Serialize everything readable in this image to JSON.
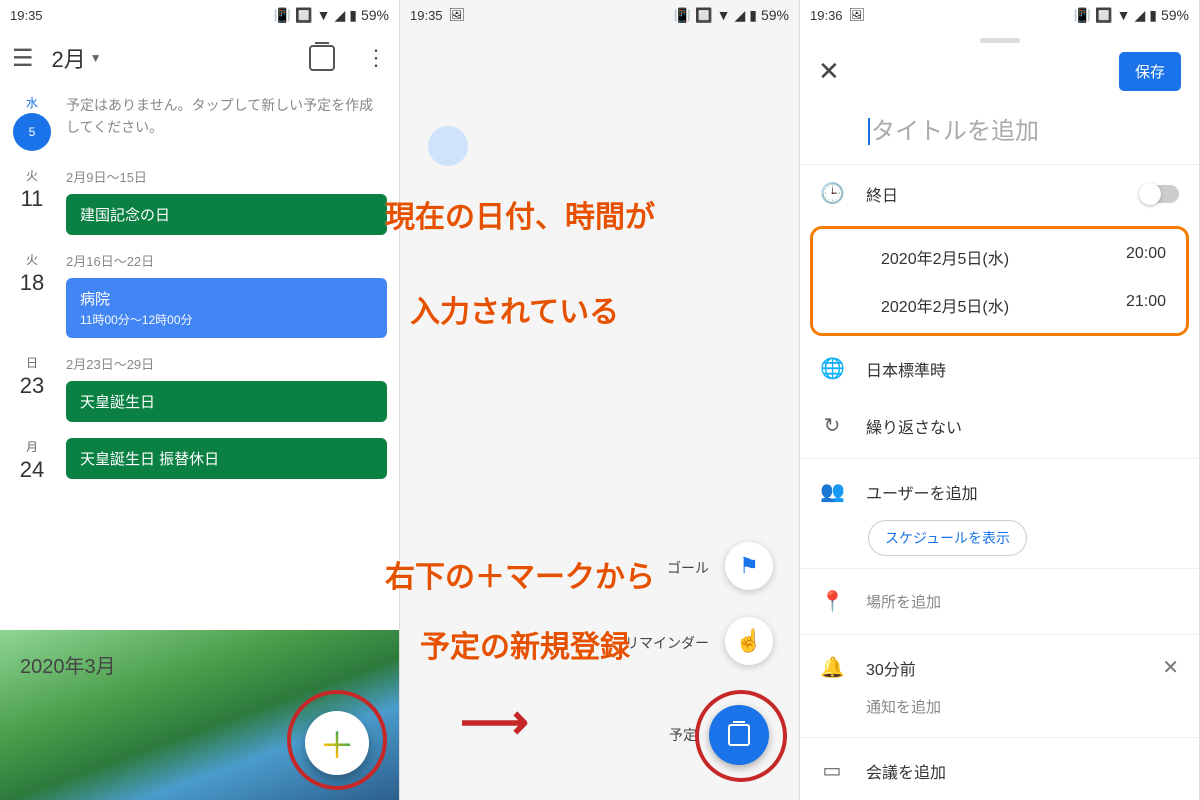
{
  "status": {
    "time1": "19:35",
    "time2": "19:35",
    "time3": "19:36",
    "battery": "59%"
  },
  "p1": {
    "month": "2月",
    "today_wd": "水",
    "today_num": "5",
    "noev": "予定はありません。タップして新しい予定を作成してください。",
    "weeks": [
      {
        "range": "2月9日～15日",
        "wd": "火",
        "num": "11",
        "title": "建国記念の日",
        "cls": "teal"
      },
      {
        "range": "2月16日～22日",
        "wd": "火",
        "num": "18",
        "title": "病院",
        "sub": "11時00分～12時00分",
        "cls": "blue"
      },
      {
        "range": "2月23日～29日",
        "wd": "日",
        "num": "23",
        "title": "天皇誕生日",
        "cls": "teal"
      },
      {
        "range": "",
        "wd": "月",
        "num": "24",
        "title": "天皇誕生日 振替休日",
        "cls": "teal"
      }
    ],
    "next_month": "2020年3月"
  },
  "p2": {
    "options": [
      {
        "label": "ゴール",
        "icon": "⚑"
      },
      {
        "label": "リマインダー",
        "icon": "☝"
      },
      {
        "label": "予定",
        "icon": "cal"
      }
    ]
  },
  "p3": {
    "save": "保存",
    "title_ph": "タイトルを追加",
    "allday": "終日",
    "start_date": "2020年2月5日(水)",
    "start_time": "20:00",
    "end_date": "2020年2月5日(水)",
    "end_time": "21:00",
    "tz": "日本標準時",
    "repeat": "繰り返さない",
    "adduser": "ユーザーを追加",
    "schedule": "スケジュールを表示",
    "location": "場所を追加",
    "notify": "30分前",
    "addnotify": "通知を追加",
    "meeting": "会議を追加"
  },
  "ann": {
    "a1": "現在の日付、時間が",
    "a2": "入力されている",
    "a3": "右下の＋マークから",
    "a4": "予定の新規登録"
  }
}
